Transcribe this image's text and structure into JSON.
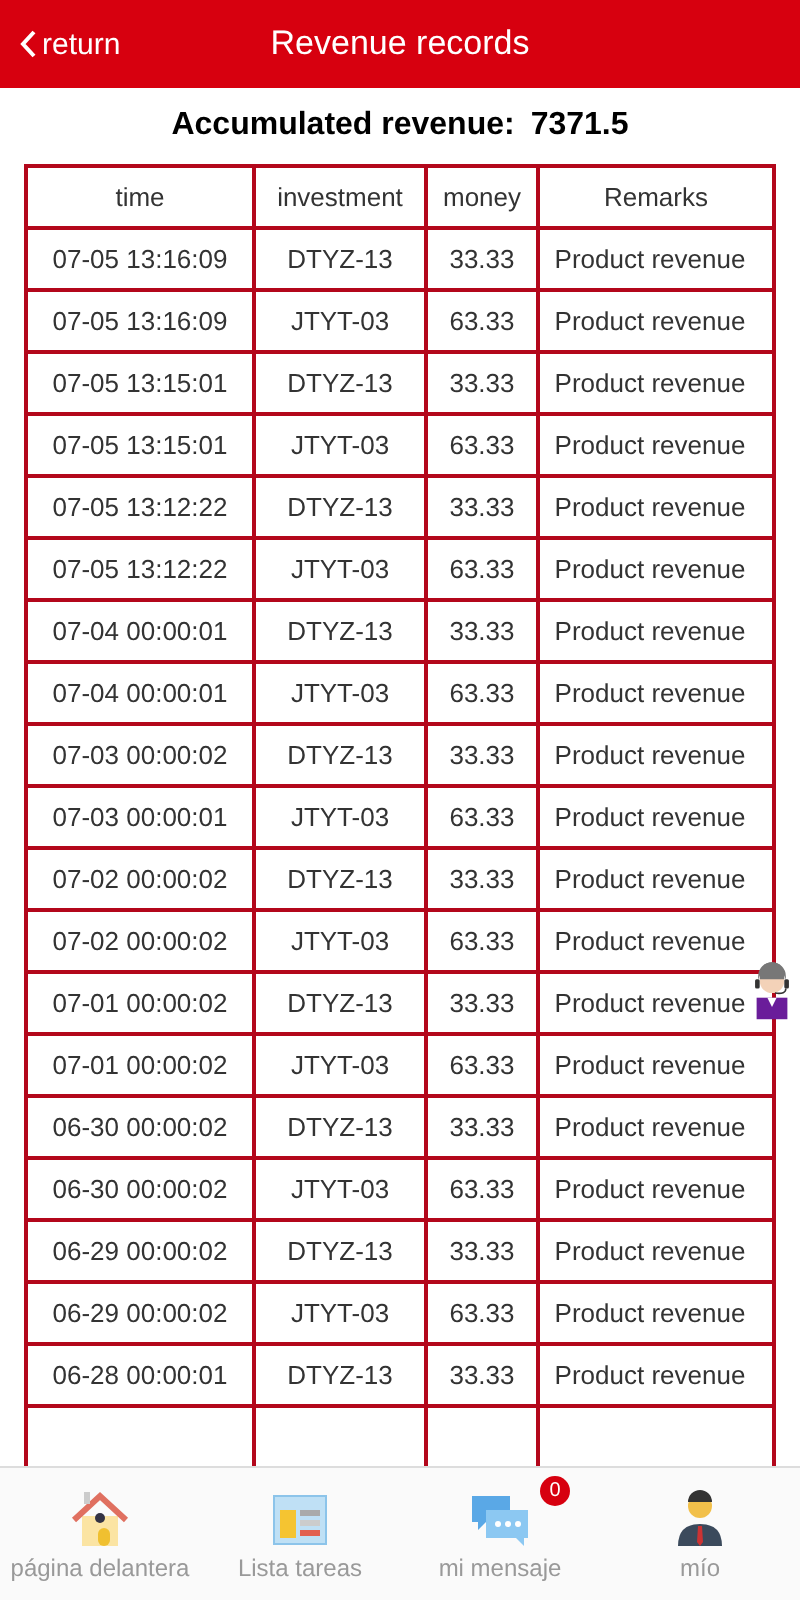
{
  "header": {
    "back": "return",
    "title": "Revenue records"
  },
  "summary": {
    "label": "Accumulated revenue:",
    "value": "7371.5"
  },
  "table": {
    "columns": [
      "time",
      "investment",
      "money",
      "Remarks"
    ],
    "rows": [
      [
        "07-05 13:16:09",
        "DTYZ-13",
        "33.33",
        "Product revenue"
      ],
      [
        "07-05 13:16:09",
        "JTYT-03",
        "63.33",
        "Product revenue"
      ],
      [
        "07-05 13:15:01",
        "DTYZ-13",
        "33.33",
        "Product revenue"
      ],
      [
        "07-05 13:15:01",
        "JTYT-03",
        "63.33",
        "Product revenue"
      ],
      [
        "07-05 13:12:22",
        "DTYZ-13",
        "33.33",
        "Product revenue"
      ],
      [
        "07-05 13:12:22",
        "JTYT-03",
        "63.33",
        "Product revenue"
      ],
      [
        "07-04 00:00:01",
        "DTYZ-13",
        "33.33",
        "Product revenue"
      ],
      [
        "07-04 00:00:01",
        "JTYT-03",
        "63.33",
        "Product revenue"
      ],
      [
        "07-03 00:00:02",
        "DTYZ-13",
        "33.33",
        "Product revenue"
      ],
      [
        "07-03 00:00:01",
        "JTYT-03",
        "63.33",
        "Product revenue"
      ],
      [
        "07-02 00:00:02",
        "DTYZ-13",
        "33.33",
        "Product revenue"
      ],
      [
        "07-02 00:00:02",
        "JTYT-03",
        "63.33",
        "Product revenue"
      ],
      [
        "07-01 00:00:02",
        "DTYZ-13",
        "33.33",
        "Product revenue"
      ],
      [
        "07-01 00:00:02",
        "JTYT-03",
        "63.33",
        "Product revenue"
      ],
      [
        "06-30 00:00:02",
        "DTYZ-13",
        "33.33",
        "Product revenue"
      ],
      [
        "06-30 00:00:02",
        "JTYT-03",
        "63.33",
        "Product revenue"
      ],
      [
        "06-29 00:00:02",
        "DTYZ-13",
        "33.33",
        "Product revenue"
      ],
      [
        "06-29 00:00:02",
        "JTYT-03",
        "63.33",
        "Product revenue"
      ],
      [
        "06-28 00:00:01",
        "DTYZ-13",
        "33.33",
        "Product revenue"
      ]
    ]
  },
  "nav": [
    {
      "kind": "home",
      "label": "página delantera"
    },
    {
      "kind": "tasks",
      "label": "Lista tareas"
    },
    {
      "kind": "messages",
      "label": "mi mensaje",
      "badge": "0"
    },
    {
      "kind": "profile",
      "label": "mío"
    }
  ]
}
